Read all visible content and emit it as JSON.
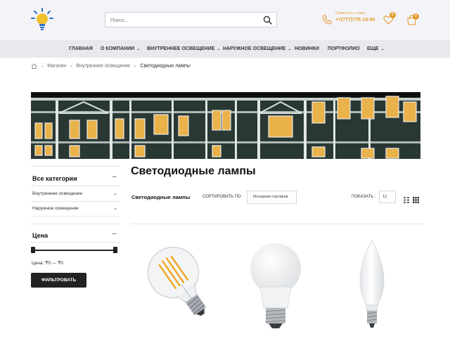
{
  "header": {
    "search_placeholder": "Поиск...",
    "contact_label": "Свяжитесь с нами",
    "contact_phone": "+7(777)776-18-00",
    "wishlist_count": "0",
    "cart_count": "0"
  },
  "nav": {
    "items": [
      {
        "label": "ГЛАВНАЯ",
        "has_dropdown": false
      },
      {
        "label": "О КОМПАНИИ",
        "has_dropdown": true
      },
      {
        "label": "ВНУТРЕННЕЕ ОСВЕЩЕНИЕ",
        "has_dropdown": true
      },
      {
        "label": "НАРУЖНОЕ ОСВЕЩЕНИЕ",
        "has_dropdown": true
      },
      {
        "label": "НОВИНКИ",
        "has_dropdown": false
      },
      {
        "label": "ПОРТФОЛИО",
        "has_dropdown": false
      },
      {
        "label": "ЕЩЕ",
        "has_dropdown": true
      }
    ]
  },
  "breadcrumb": {
    "items": [
      "Магазин",
      "Внутреннее освещение"
    ],
    "current": "Светодиодные лампы"
  },
  "sidebar": {
    "categories_title": "Все категории",
    "categories": [
      "Внутреннее освещение",
      "Наружное освещение"
    ],
    "price_title": "Цена",
    "price_range_text": "Цена: ₸0 — ₸0",
    "filter_button": "ФИЛЬТРОВАТЬ"
  },
  "main": {
    "title": "Светодиодные лампы",
    "toolbar": {
      "category_label": "Светодиодные лампы",
      "sort_label": "СОРТИРОВАТЬ ПО :",
      "sort_value": "Исходная сортиров",
      "show_label": "ПОКАЗАТЬ :",
      "show_value": "12"
    },
    "products": [
      {
        "image": "filament-bulb-image"
      },
      {
        "image": "led-bulb-image"
      },
      {
        "image": "candle-bulb-image"
      }
    ]
  },
  "colors": {
    "accent": "#e29a2d",
    "logo_blue": "#2b6fc2",
    "dark": "#222222",
    "nav_bg": "#e8e9ef",
    "topbar_bg": "#f4f4f8"
  }
}
